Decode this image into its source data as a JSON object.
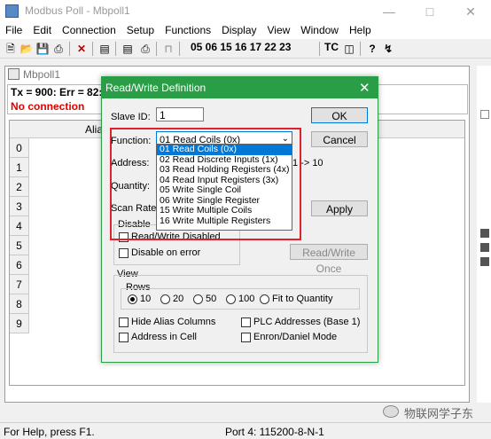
{
  "app": {
    "title": "Modbus Poll - Mbpoll1"
  },
  "menu": [
    "File",
    "Edit",
    "Connection",
    "Setup",
    "Functions",
    "Display",
    "View",
    "Window",
    "Help"
  ],
  "toolbar": {
    "codes": "05 06 15 16 17 22 23",
    "tc": "TC"
  },
  "child": {
    "title": "Mbpoll1",
    "status_line": "Tx = 900: Err = 82:",
    "error": "No connection",
    "alias_header": "Alias",
    "rows": [
      "0",
      "1",
      "2",
      "3",
      "4",
      "5",
      "6",
      "7",
      "8",
      "9"
    ]
  },
  "statusbar": {
    "help": "For Help, press F1.",
    "port": "Port 4: 115200-8-N-1"
  },
  "watermark": "物联网学子东",
  "dialog": {
    "title": "Read/Write Definition",
    "slave_id_label": "Slave ID:",
    "slave_id_value": "1",
    "function_label": "Function:",
    "function_selected": "01 Read Coils (0x)",
    "address_label": "Address:",
    "address_range": "1 -> 10",
    "quantity_label": "Quantity:",
    "scan_rate_label": "Scan Rate:",
    "disable_label": "Disable",
    "rw_disabled": "Read/Write Disabled",
    "disable_on_error": "Disable on error",
    "ok": "OK",
    "cancel": "Cancel",
    "apply": "Apply",
    "read_write_once": "Read/Write Once",
    "view_label": "View",
    "rows_label": "Rows",
    "rows_options": [
      "10",
      "20",
      "50",
      "100",
      "Fit to Quantity"
    ],
    "hide_alias": "Hide Alias Columns",
    "address_in_cell": "Address in Cell",
    "plc_addresses": "PLC Addresses (Base 1)",
    "enron": "Enron/Daniel Mode",
    "function_options": [
      "01 Read Coils (0x)",
      "02 Read Discrete Inputs (1x)",
      "03 Read Holding Registers (4x)",
      "04 Read Input Registers (3x)",
      "05 Write Single Coil",
      "06 Write Single Register",
      "15 Write Multiple Coils",
      "16 Write Multiple Registers"
    ]
  },
  "colors": {
    "dialog_title": "#2a9e46",
    "highlight": "#0078d7",
    "annotation": "#e0202a",
    "error_text": "#e00000"
  }
}
